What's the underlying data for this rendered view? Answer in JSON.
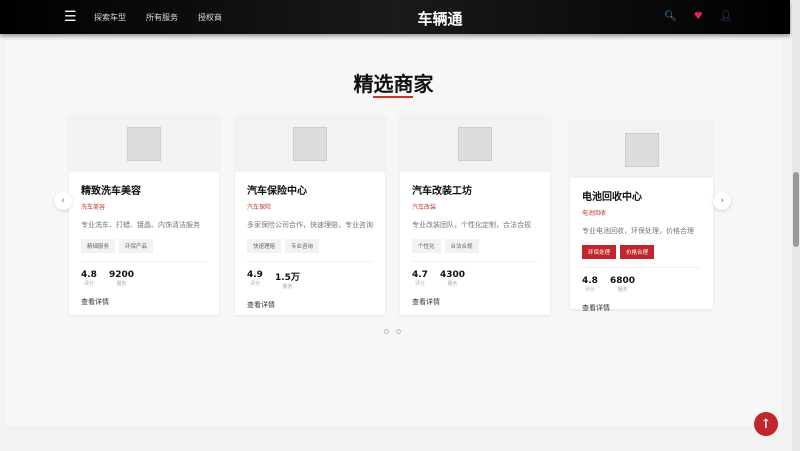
{
  "nav": {
    "menu_icon": "hamburger-icon",
    "links": [
      "探索车型",
      "所有服务",
      "授权商"
    ],
    "brand": "车辆通",
    "icons": [
      "search-icon",
      "heart-icon",
      "user-icon"
    ]
  },
  "section": {
    "title": "精选商家"
  },
  "merchants": [
    {
      "name": "精致洗车美容",
      "category": "洗车美容",
      "description": "专业洗车、打蜡、镀晶、内饰清洁服务",
      "tags": [
        "精细服务",
        "环保产品"
      ],
      "rating": "4.8",
      "rating_label": "评分",
      "services": "9200",
      "services_label": "服务",
      "link": "查看详情"
    },
    {
      "name": "汽车保险中心",
      "category": "汽车保险",
      "description": "多家保险公司合作，快速理赔，专业咨询",
      "tags": [
        "快速理赔",
        "专业咨询"
      ],
      "rating": "4.9",
      "rating_label": "评分",
      "services": "1.5万",
      "services_label": "服务",
      "link": "查看详情"
    },
    {
      "name": "汽车改装工坊",
      "category": "汽车改装",
      "description": "专业改装团队，个性化定制，合法合规",
      "tags": [
        "个性化",
        "合法合规"
      ],
      "rating": "4.7",
      "rating_label": "评分",
      "services": "4300",
      "services_label": "服务",
      "link": "查看详情"
    },
    {
      "name": "电池回收中心",
      "category": "电池回收",
      "description": "专业电池回收，环保处理，价格合理",
      "tags": [
        "环保处理",
        "价格合理"
      ],
      "rating": "4.8",
      "rating_label": "评分",
      "services": "6800",
      "services_label": "服务",
      "link": "查看详情"
    }
  ],
  "colors": {
    "accent": "#c0262b",
    "nav": "#000000"
  }
}
